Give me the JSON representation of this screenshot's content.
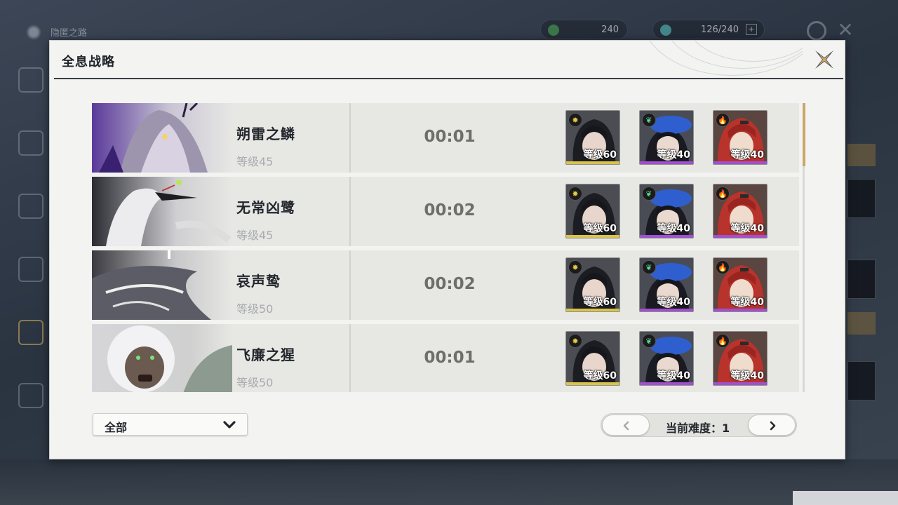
{
  "background": {
    "screen_title": "隐匿之路",
    "resource_1": "240",
    "resource_2": "126/240"
  },
  "dialog": {
    "title": "全息战略"
  },
  "records": [
    {
      "boss_name": "朔雷之鳞",
      "boss_level": "等级45",
      "clear_time": "00:01",
      "team": [
        {
          "level": "等级60",
          "element": "spectro"
        },
        {
          "level": "等级40",
          "element": "aero"
        },
        {
          "level": "等级40",
          "element": "fusion"
        }
      ]
    },
    {
      "boss_name": "无常凶鹭",
      "boss_level": "等级45",
      "clear_time": "00:02",
      "team": [
        {
          "level": "等级60",
          "element": "spectro"
        },
        {
          "level": "等级40",
          "element": "aero"
        },
        {
          "level": "等级40",
          "element": "fusion"
        }
      ]
    },
    {
      "boss_name": "哀声鸷",
      "boss_level": "等级50",
      "clear_time": "00:02",
      "team": [
        {
          "level": "等级60",
          "element": "spectro"
        },
        {
          "level": "等级40",
          "element": "aero"
        },
        {
          "level": "等级40",
          "element": "fusion"
        }
      ]
    },
    {
      "boss_name": "飞廉之猩",
      "boss_level": "等级50",
      "clear_time": "00:01",
      "team": [
        {
          "level": "等级60",
          "element": "spectro"
        },
        {
          "level": "等级40",
          "element": "aero"
        },
        {
          "level": "等级40",
          "element": "fusion"
        }
      ]
    }
  ],
  "footer": {
    "filter_selected": "全部",
    "difficulty_label": "当前难度：",
    "difficulty_value": "1",
    "prev_icon": "chevron-left-icon",
    "next_icon": "chevron-right-icon"
  },
  "colors": {
    "accent_gold": "#c7a86a",
    "rarity_5": "#d9c34a",
    "rarity_4": "#a24fd0",
    "spectro": "#e6c84a",
    "aero": "#57d69a",
    "fusion": "#ef6a3a"
  }
}
